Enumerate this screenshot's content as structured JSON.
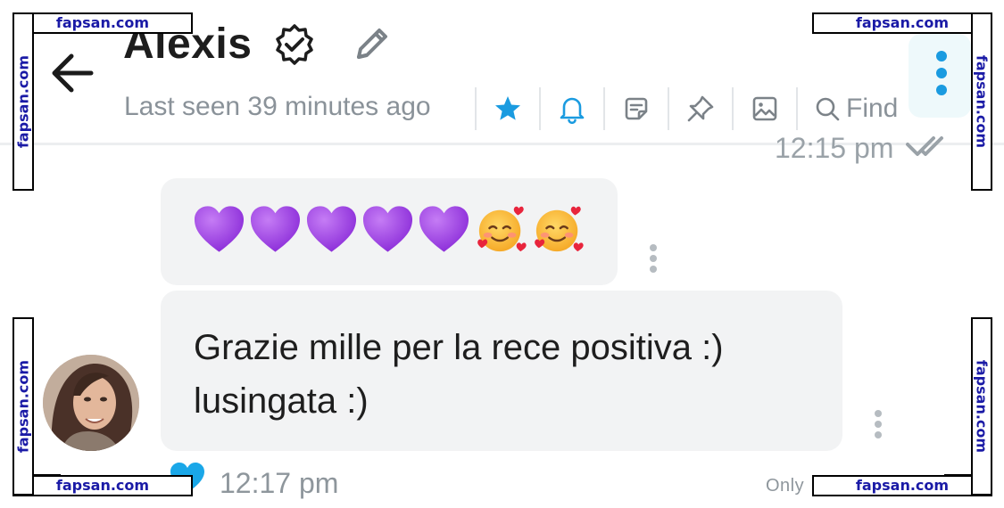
{
  "header": {
    "title": "Alexis",
    "last_seen": "Last seen 39 minutes ago",
    "toolbar": {
      "find_label": "Find",
      "icons": [
        "star-icon",
        "bell-icon",
        "note-icon",
        "pin-icon",
        "image-icon",
        "search-icon"
      ]
    },
    "menu_icon": "kebab-vertical-icon"
  },
  "previous_message": {
    "time": "12:15 pm"
  },
  "messages": [
    {
      "type": "emoji",
      "emojis": [
        "purple-heart",
        "purple-heart",
        "purple-heart",
        "purple-heart",
        "purple-heart",
        "smiling-face-with-hearts",
        "smiling-face-with-hearts"
      ]
    },
    {
      "type": "text",
      "text": "Grazie mille per la rece positiva :) lusingata :)"
    }
  ],
  "message_meta": {
    "time": "12:17 pm",
    "trailing_label": "Only"
  },
  "watermark": {
    "text": "fapsan.com"
  },
  "colors": {
    "accent_blue": "#1a9be0",
    "purple_heart": "#9c3fe0",
    "bubble_bg": "#f2f3f4",
    "muted_text": "#8a9299",
    "watermark_text": "#1a1aa6"
  }
}
